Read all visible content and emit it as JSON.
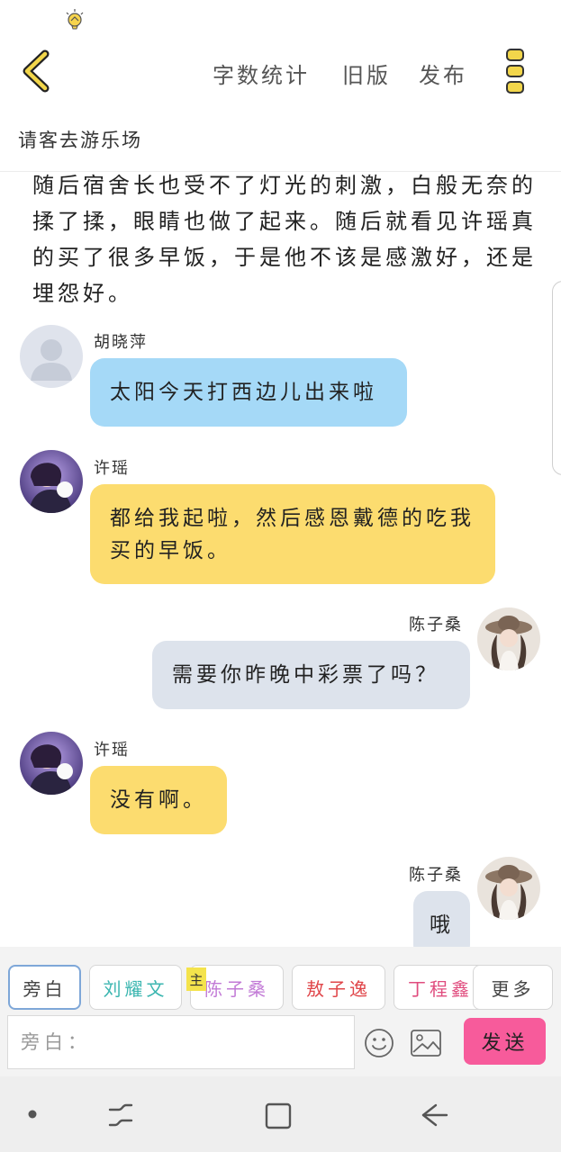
{
  "header": {
    "word_count": "字数统计",
    "old_version": "旧版",
    "publish": "发布"
  },
  "story_title": "请客去游乐场",
  "narration": "随后宿舍长也受不了灯光的刺激，白般无奈的揉了揉，眼睛也做了起来。随后就看见许瑶真的买了很多早饭，于是他不该是感激好，还是埋怨好。",
  "messages": [
    {
      "sender": "胡晓萍",
      "text": "太阳今天打西边儿出来啦",
      "color": "blue",
      "side": "left",
      "avatar": "default-avatar"
    },
    {
      "sender": "许瑶",
      "text": "都给我起啦，然后感恩戴德的吃我买的早饭。",
      "color": "yellow",
      "side": "left",
      "avatar": "photo-avatar"
    },
    {
      "sender": "陈子桑",
      "text": "需要你昨晚中彩票了吗？",
      "color": "gray",
      "side": "right",
      "avatar": "photo-avatar"
    },
    {
      "sender": "许瑶",
      "text": "没有啊。",
      "color": "yellow",
      "side": "left",
      "avatar": "photo-avatar"
    },
    {
      "sender": "陈子桑",
      "text": "哦",
      "color": "gray",
      "side": "right",
      "avatar": "photo-avatar"
    }
  ],
  "characters": {
    "narrator": {
      "label": "旁白",
      "color": "#444444"
    },
    "c1": {
      "label": "刘耀文",
      "color": "#3bb6b0"
    },
    "c2": {
      "label": "陈子桑",
      "color": "#c27ad6"
    },
    "c3": {
      "label": "敖子逸",
      "color": "#e0464a"
    },
    "c4": {
      "label": "丁程鑫",
      "color": "#e04c7e"
    },
    "more": {
      "label": "更多",
      "color": "#444444"
    },
    "host_badge": "主"
  },
  "input": {
    "placeholder": "旁白：",
    "send_label": "发送"
  },
  "colors": {
    "accent_yellow": "#f2d64b",
    "bubble_blue": "#a5d9f7",
    "bubble_yellow": "#fcdc6f",
    "bubble_gray": "#dde3ec",
    "send_pink": "#f75b9b"
  }
}
